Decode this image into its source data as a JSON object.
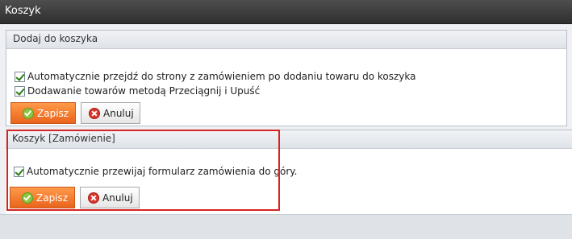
{
  "window": {
    "title": "Koszyk"
  },
  "panels": [
    {
      "header": "Dodaj do koszyka",
      "options": [
        {
          "label": "Automatycznie przejdź do strony z zamówieniem po dodaniu towaru do koszyka",
          "checked": true
        },
        {
          "label": "Dodawanie towarów metodą Przeciągnij i Upuść",
          "checked": true
        }
      ],
      "save_label": "Zapisz",
      "cancel_label": "Anuluj"
    },
    {
      "header": "Koszyk [Zamówienie]",
      "options": [
        {
          "label": "Automatycznie przewijaj formularz zamówienia do góry.",
          "checked": true
        }
      ],
      "save_label": "Zapisz",
      "cancel_label": "Anuluj"
    }
  ],
  "icons": {
    "save": "check-circle-icon",
    "cancel": "x-circle-icon"
  },
  "colors": {
    "highlight": "#d62424",
    "save_button": "#f07a2e"
  }
}
